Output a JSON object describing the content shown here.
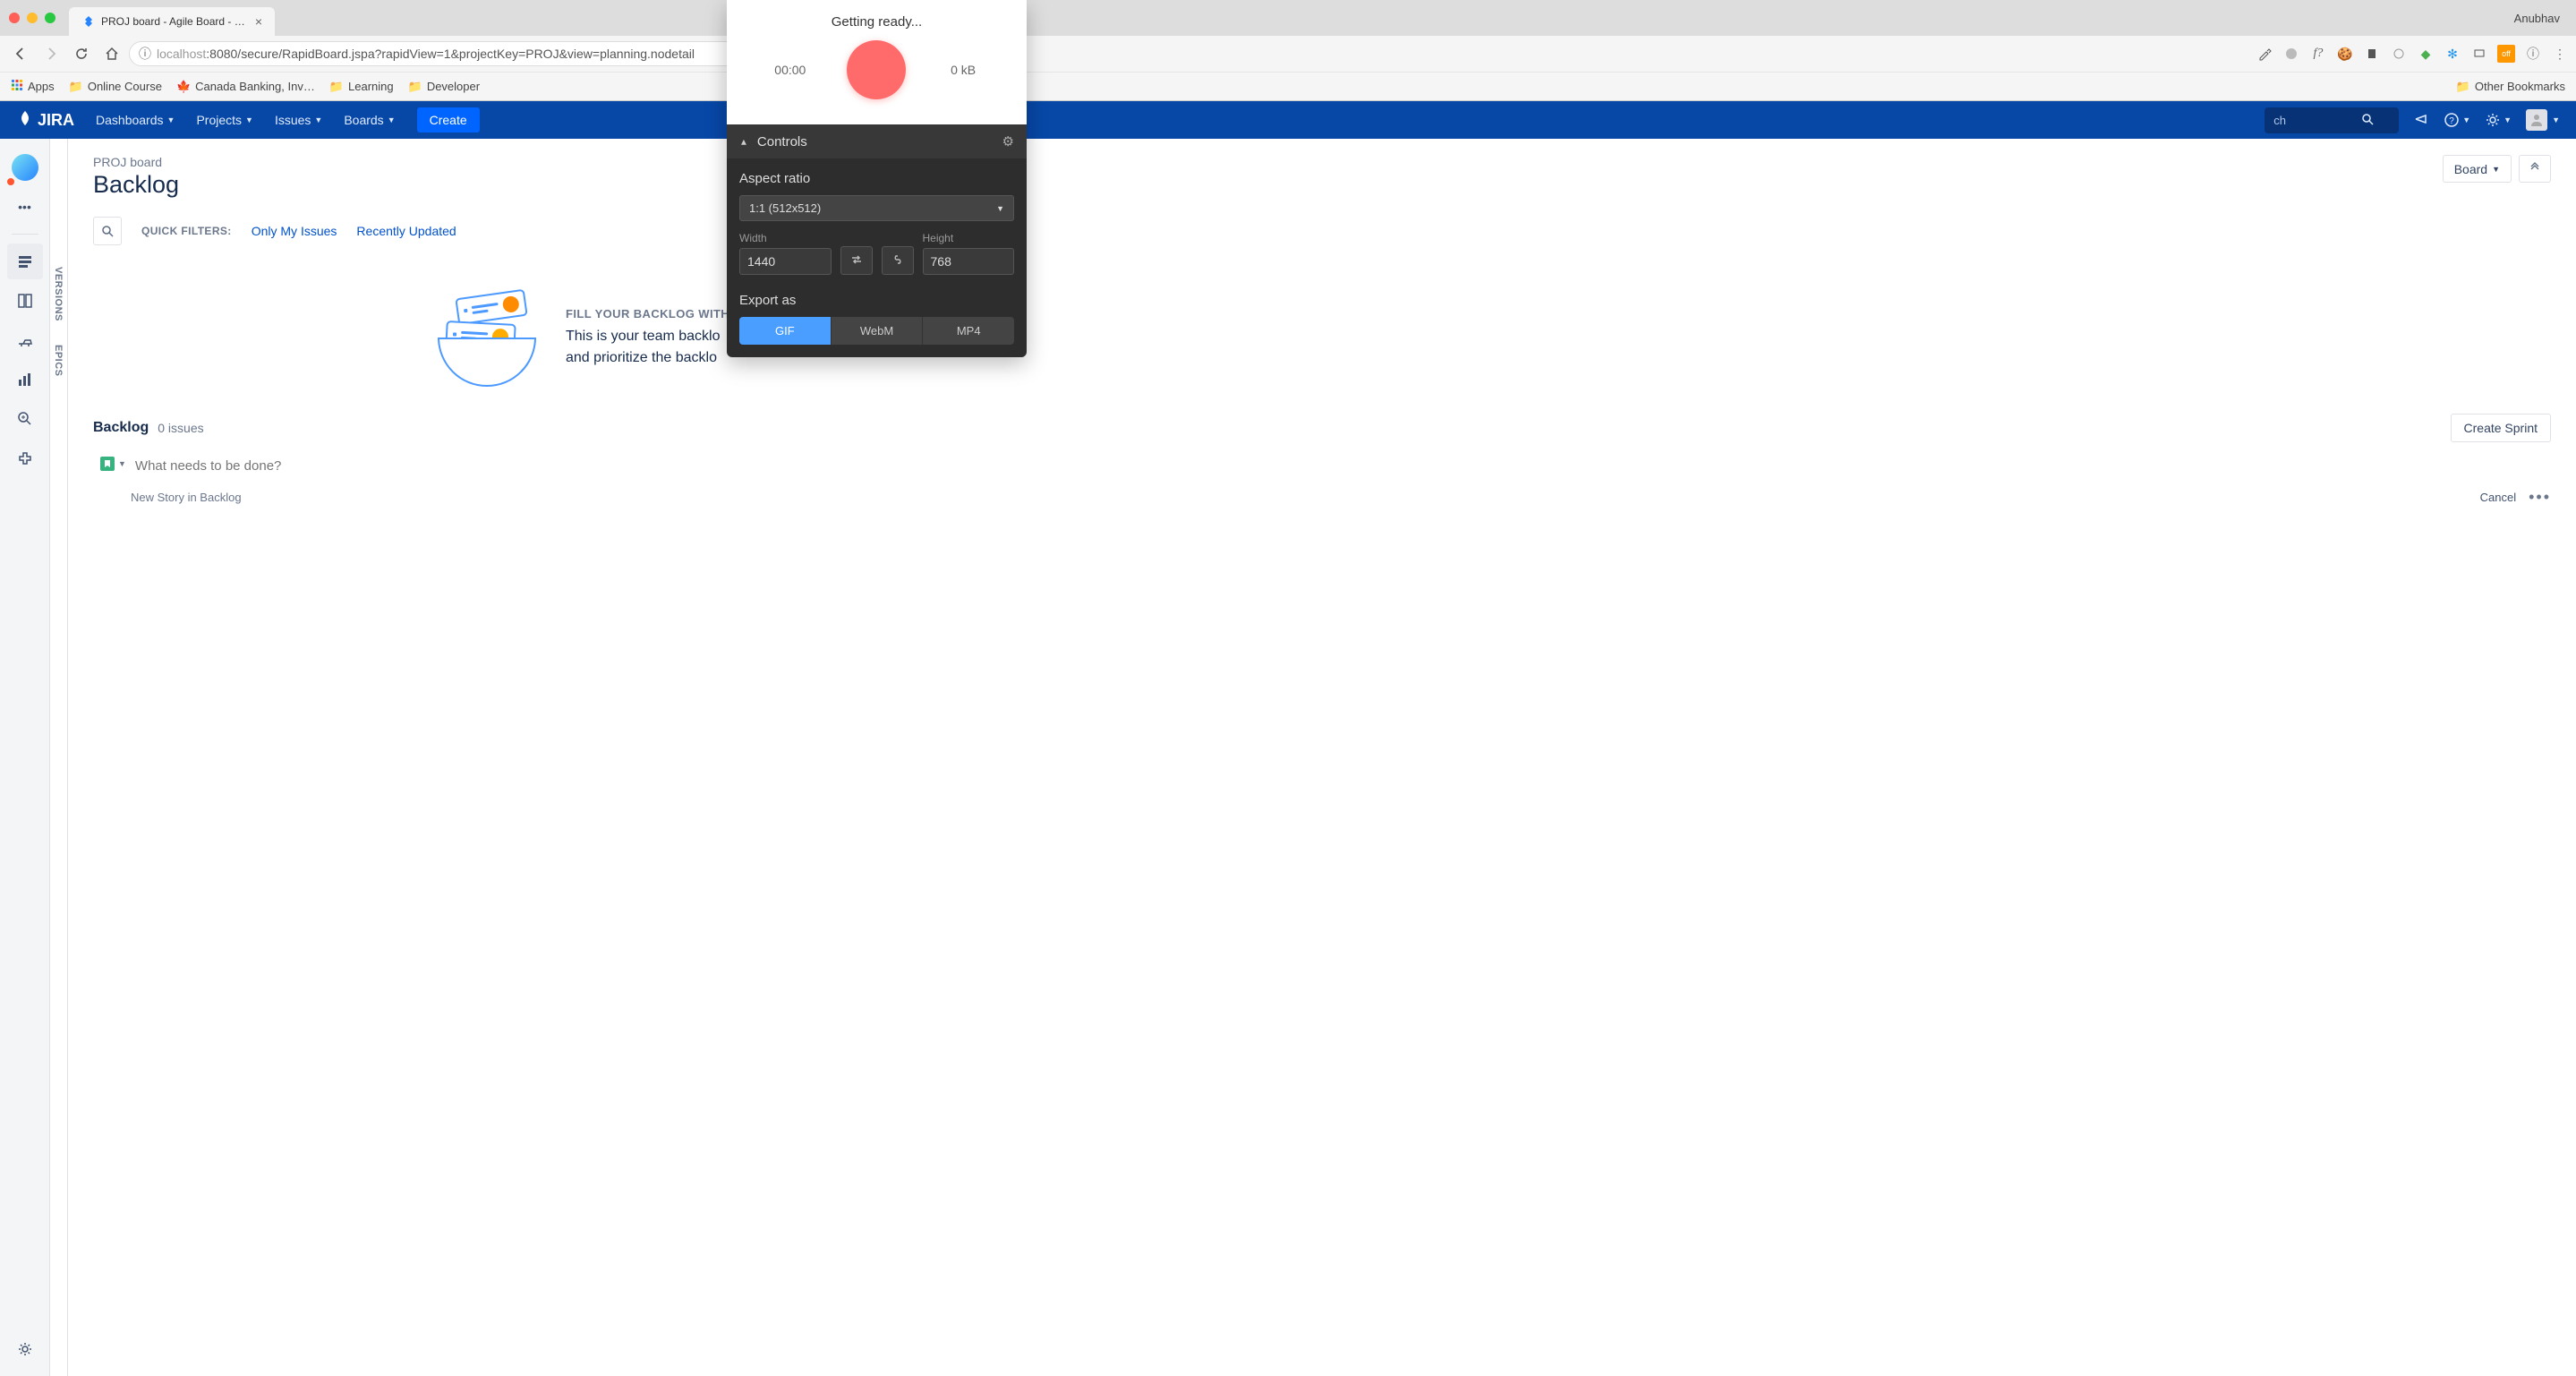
{
  "browser": {
    "tab_title": "PROJ board - Agile Board - JIR",
    "profile_name": "Anubhav",
    "url_host_muted": "localhost",
    "url_port_path": ":8080/secure/RapidBoard.jspa?rapidView=1&projectKey=PROJ&view=planning.nodetail",
    "bookmarks": {
      "apps": "Apps",
      "items": [
        "Online Course",
        "Canada Banking, Inv…",
        "Learning",
        "Developer"
      ],
      "other": "Other Bookmarks"
    }
  },
  "jira_nav": {
    "logo": "JIRA",
    "menus": [
      "Dashboards",
      "Projects",
      "Issues",
      "Boards"
    ],
    "create": "Create",
    "search_placeholder": "ch"
  },
  "board": {
    "project_name": "PROJ board",
    "page_title": "Backlog",
    "board_switcher": "Board",
    "quick_filters_label": "QUICK FILTERS:",
    "quick_filters": [
      "Only My Issues",
      "Recently Updated"
    ]
  },
  "empty_state": {
    "heading": "FILL YOUR BACKLOG WITH IS",
    "body_line1": "This is your team backlo",
    "body_line2": "and prioritize the backlo"
  },
  "backlog": {
    "title": "Backlog",
    "issue_count": "0 issues",
    "create_sprint": "Create Sprint",
    "new_story_placeholder": "What needs to be done?",
    "new_story_subtitle": "New Story in Backlog",
    "cancel": "Cancel"
  },
  "recorder": {
    "status": "Getting ready...",
    "time": "00:00",
    "size": "0 kB",
    "controls_title": "Controls",
    "aspect_ratio_label": "Aspect ratio",
    "aspect_ratio_value": "1:1 (512x512)",
    "width_label": "Width",
    "width_value": "1440",
    "height_label": "Height",
    "height_value": "768",
    "export_label": "Export as",
    "export_options": [
      "GIF",
      "WebM",
      "MP4"
    ],
    "export_active": "GIF"
  }
}
